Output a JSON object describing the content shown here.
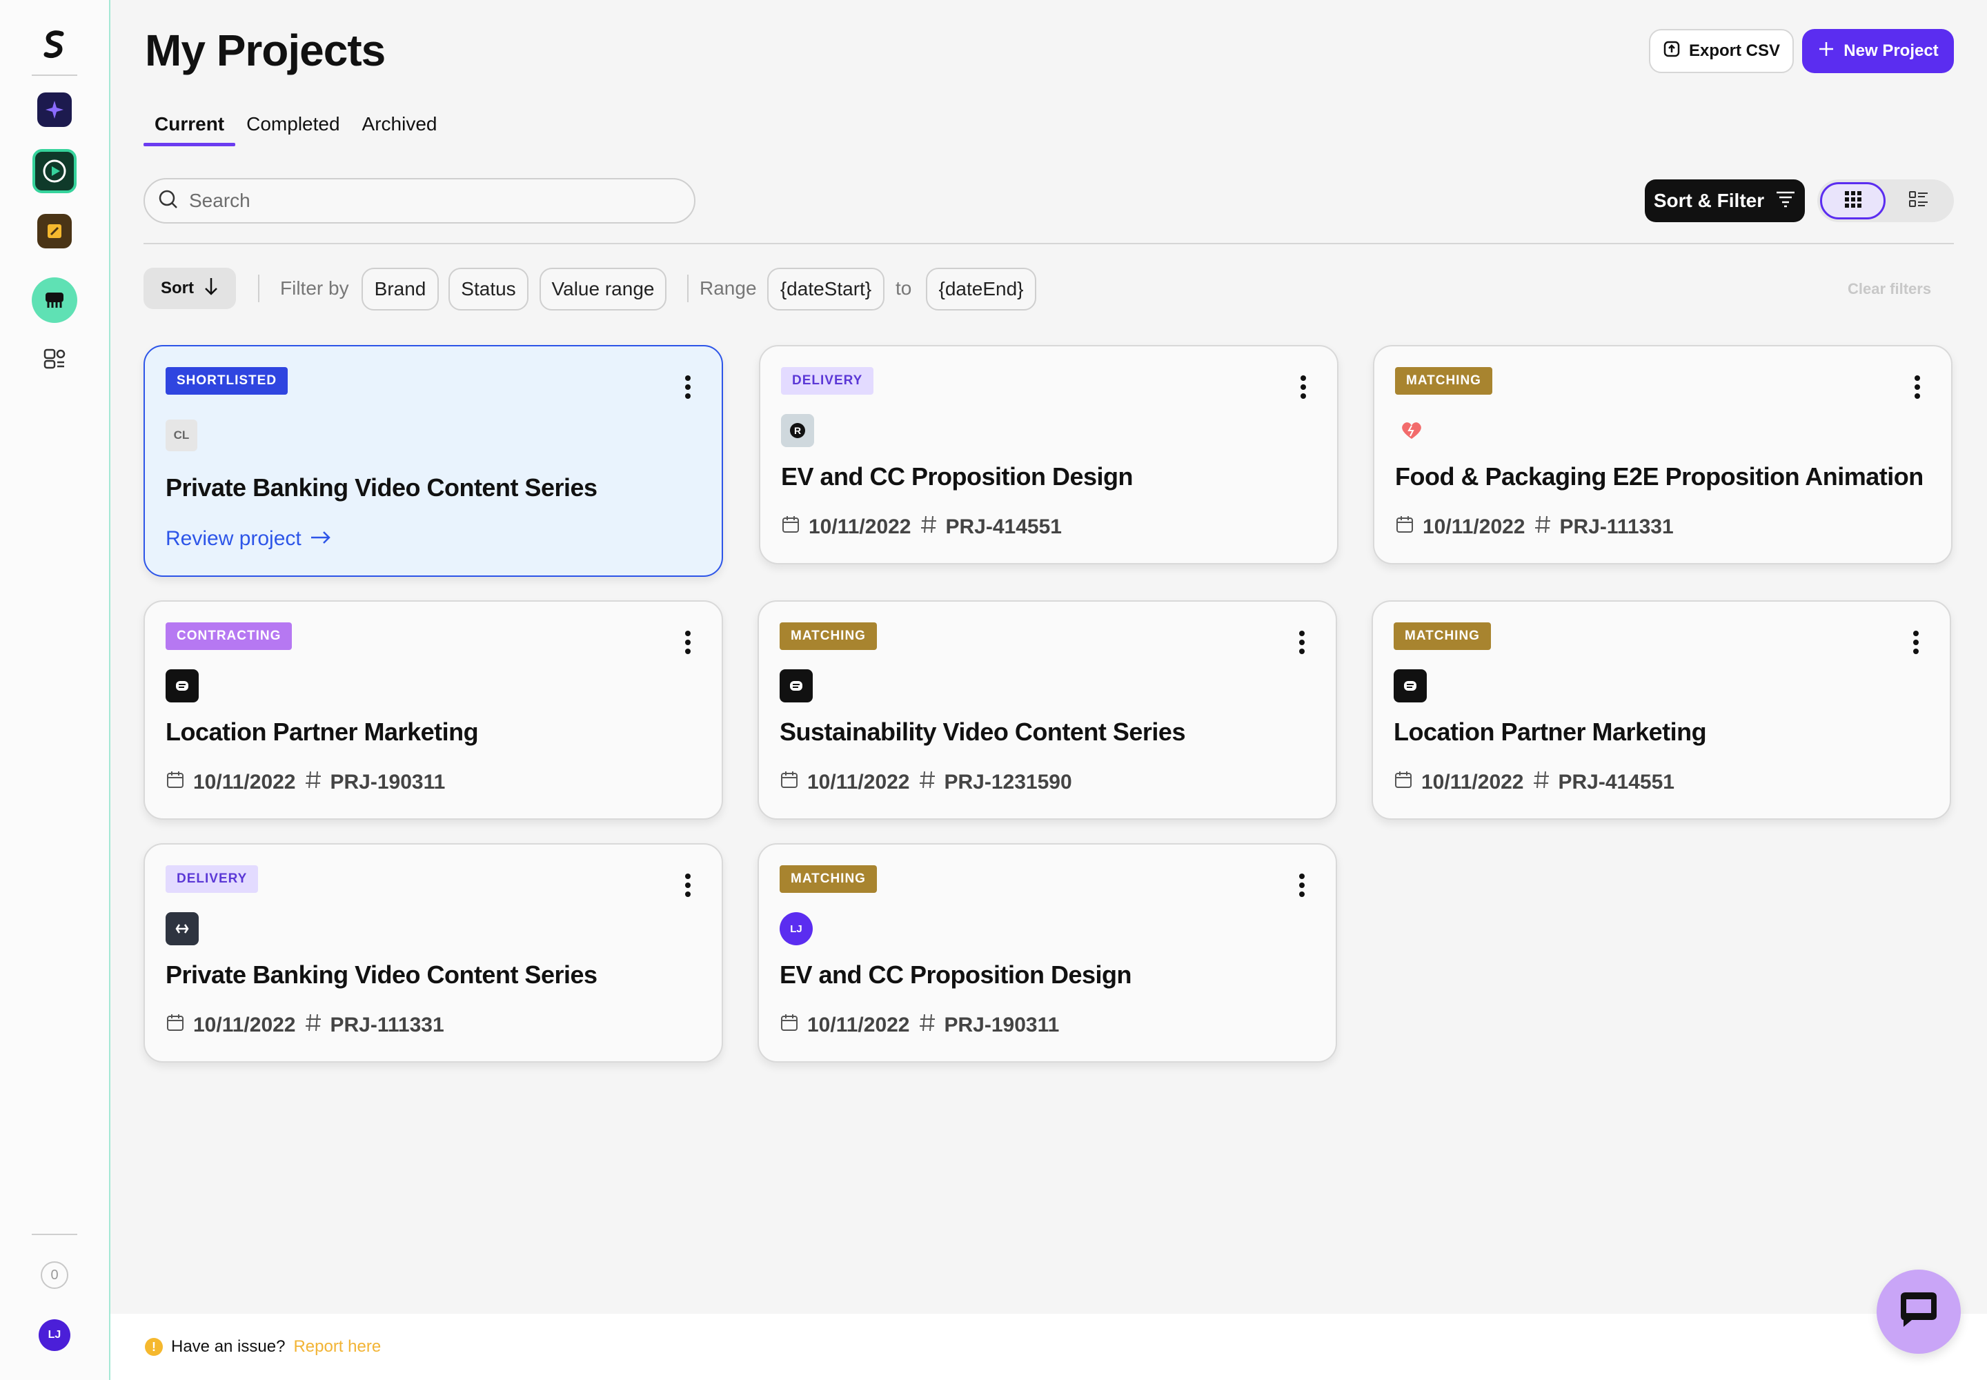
{
  "header": {
    "title": "My Projects",
    "export_label": "Export CSV",
    "new_project_label": "New Project"
  },
  "tabs": [
    {
      "label": "Current",
      "active": true
    },
    {
      "label": "Completed",
      "active": false
    },
    {
      "label": "Archived",
      "active": false
    }
  ],
  "search": {
    "placeholder": "Search",
    "value": ""
  },
  "toolbar": {
    "sort_filter_label": "Sort & Filter",
    "view_mode": "grid"
  },
  "filters": {
    "sort_label": "Sort",
    "filter_by_label": "Filter by",
    "chips": [
      "Brand",
      "Status",
      "Value range"
    ],
    "range_label": "Range",
    "date_start": "{dateStart}",
    "to_label": "to",
    "date_end": "{dateEnd}",
    "clear_label": "Clear filters"
  },
  "projects": [
    {
      "status": "SHORTLISTED",
      "logo": "CL",
      "title": "Private Banking Video Content Series",
      "link_label": "Review project",
      "selected": true
    },
    {
      "status": "DELIVERY",
      "logo": "R",
      "title": "EV and CC Proposition Design",
      "date": "10/11/2022",
      "id": "PRJ-414551"
    },
    {
      "status": "MATCHING",
      "logo": "heart",
      "title": "Food & Packaging E2E Proposition Animation",
      "date": "10/11/2022",
      "id": "PRJ-111331"
    },
    {
      "status": "CONTRACTING",
      "logo": "black",
      "title": "Location Partner Marketing",
      "date": "10/11/2022",
      "id": "PRJ-190311"
    },
    {
      "status": "MATCHING",
      "logo": "black",
      "title": "Sustainability Video Content Series",
      "date": "10/11/2022",
      "id": "PRJ-1231590"
    },
    {
      "status": "MATCHING",
      "logo": "black",
      "title": "Location Partner Marketing",
      "date": "10/11/2022",
      "id": "PRJ-414551"
    },
    {
      "status": "DELIVERY",
      "logo": "dark",
      "title": "Private Banking Video Content Series",
      "date": "10/11/2022",
      "id": "PRJ-111331"
    },
    {
      "status": "MATCHING",
      "logo": "LJ",
      "title": "EV and CC Proposition Design",
      "date": "10/11/2022",
      "id": "PRJ-190311"
    }
  ],
  "sidebar": {
    "notification_count": "0",
    "avatar_initials": "LJ"
  },
  "footer": {
    "issue_text": "Have an issue?",
    "report_link": "Report here"
  },
  "colors": {
    "accent": "#5b2df0",
    "shortlisted": "#2f45e0",
    "matching": "#a8842f",
    "contracting": "#b678f2",
    "delivery_bg": "#e3dbff"
  }
}
